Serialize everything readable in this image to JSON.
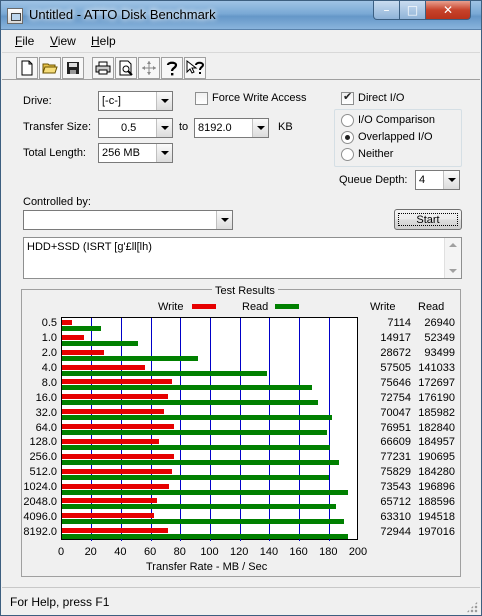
{
  "window": {
    "title": "Untitled - ATTO Disk Benchmark"
  },
  "titlebar": {
    "min_glyph": "–",
    "max_glyph": "□",
    "close_glyph": "✕"
  },
  "menu": [
    {
      "hot": "F",
      "rest": "ile"
    },
    {
      "hot": "V",
      "rest": "iew"
    },
    {
      "hot": "H",
      "rest": "elp"
    }
  ],
  "toolbar": {
    "icons": [
      "new-file-icon",
      "open-folder-icon",
      "save-icon",
      "print-icon",
      "print-preview-icon",
      "move-icon",
      "help-icon",
      "context-help-icon"
    ]
  },
  "settings": {
    "drive_label": "Drive:",
    "drive_value": "[-c-]",
    "force_write_label": "Force Write Access",
    "force_write_checked": false,
    "direct_io_label": "Direct I/O",
    "direct_io_checked": true,
    "transfer_size_label": "Transfer Size:",
    "transfer_from": "0.5",
    "to_label": "to",
    "transfer_to": "8192.0",
    "kb_label": "KB",
    "total_length_label": "Total Length:",
    "total_length_value": "256 MB",
    "io_options": [
      "I/O Comparison",
      "Overlapped I/O",
      "Neither"
    ],
    "io_selected": "Overlapped I/O",
    "queue_depth_label": "Queue Depth:",
    "queue_depth_value": "4",
    "controlled_by_label": "Controlled by:",
    "controlled_by_value": "",
    "start_label": "Start",
    "description": "HDD+SSD (ISRT [g'£ll[lh)"
  },
  "results": {
    "title": "Test Results",
    "legend_write": "Write",
    "legend_read": "Read",
    "col_write": "Write",
    "col_read": "Read",
    "xlabel": "Transfer Rate - MB / Sec",
    "colors": {
      "write": "#e60000",
      "read": "#008000",
      "grid": "#0000c8"
    }
  },
  "chart_data": {
    "type": "bar",
    "orientation": "horizontal",
    "title": "Test Results",
    "xlabel": "Transfer Rate - MB / Sec",
    "xlim": [
      0,
      200
    ],
    "xticks": [
      0,
      20,
      40,
      60,
      80,
      100,
      120,
      140,
      160,
      180,
      200
    ],
    "categories": [
      "0.5",
      "1.0",
      "2.0",
      "4.0",
      "8.0",
      "16.0",
      "32.0",
      "64.0",
      "128.0",
      "256.0",
      "512.0",
      "1024.0",
      "2048.0",
      "4096.0",
      "8192.0"
    ],
    "series": [
      {
        "name": "Write",
        "values": [
          7114,
          14917,
          28672,
          57505,
          75646,
          72754,
          70047,
          76951,
          66609,
          77231,
          75829,
          73543,
          65712,
          63310,
          72944
        ]
      },
      {
        "name": "Read",
        "values": [
          26940,
          52349,
          93499,
          141033,
          172697,
          176190,
          185982,
          182840,
          184957,
          190695,
          184280,
          196896,
          188596,
          194518,
          197016
        ]
      }
    ],
    "grid": true,
    "legend": "top"
  },
  "status": {
    "text": "For Help, press F1"
  }
}
